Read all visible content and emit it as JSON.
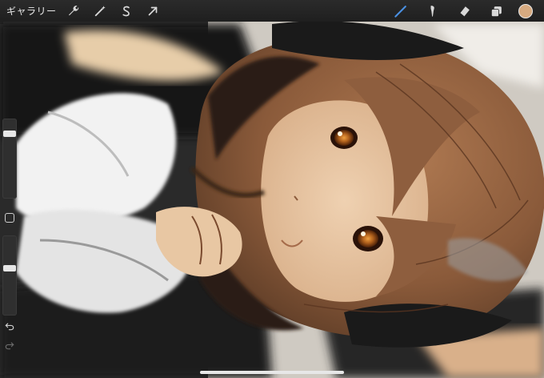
{
  "app": {
    "gallery_label": "ギャラリー",
    "accent_color": "#4a90e2",
    "current_color": "#d7aa80"
  },
  "left_tools": [
    {
      "name": "actions",
      "icon": "wrench-icon"
    },
    {
      "name": "adjustments",
      "icon": "magic-wand-icon"
    },
    {
      "name": "selection",
      "icon": "selection-s-icon"
    },
    {
      "name": "transform",
      "icon": "arrow-cursor-icon"
    }
  ],
  "right_tools": [
    {
      "name": "brush",
      "icon": "brush-icon",
      "active": true
    },
    {
      "name": "smudge",
      "icon": "smudge-icon"
    },
    {
      "name": "eraser",
      "icon": "eraser-icon"
    },
    {
      "name": "layers",
      "icon": "layers-icon"
    }
  ],
  "sidebar": {
    "brush_size": 0.85,
    "opacity": 0.6,
    "undo_icon": "undo-icon",
    "redo_icon": "redo-icon"
  }
}
